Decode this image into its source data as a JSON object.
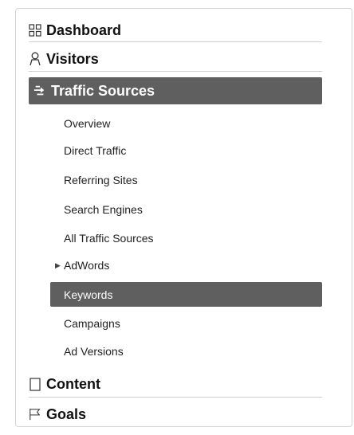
{
  "nav": {
    "sections": {
      "dashboard": {
        "label": "Dashboard",
        "icon": "grid-icon"
      },
      "visitors": {
        "label": "Visitors",
        "icon": "person-icon"
      },
      "traffic": {
        "label": "Traffic Sources",
        "icon": "arrows-icon"
      },
      "content": {
        "label": "Content",
        "icon": "document-icon"
      },
      "goals": {
        "label": "Goals",
        "icon": "flag-icon"
      }
    },
    "traffic_items": [
      {
        "label": "Overview"
      },
      {
        "label": "Direct Traffic"
      },
      {
        "label": "Referring Sites"
      },
      {
        "label": "Search Engines"
      },
      {
        "label": "All Traffic Sources"
      },
      {
        "label": "AdWords",
        "expandable": true
      },
      {
        "label": "Keywords",
        "selected": true
      },
      {
        "label": "Campaigns"
      },
      {
        "label": "Ad Versions"
      }
    ],
    "colors": {
      "active_bg": "#5f5f5f",
      "active_text": "#ffffff",
      "text": "#222222"
    }
  }
}
